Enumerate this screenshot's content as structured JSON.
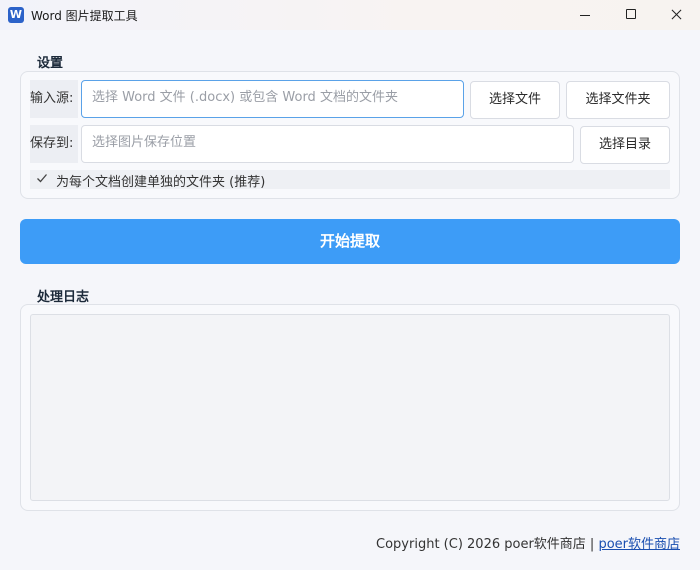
{
  "window": {
    "icon_letter": "W",
    "title": "Word 图片提取工具"
  },
  "settings": {
    "section_title": "设置",
    "source_label": "输入源:",
    "source_placeholder": "选择 Word 文件 (.docx) 或包含 Word 文档的文件夹",
    "select_file_label": "选择文件",
    "select_folder_label": "选择文件夹",
    "save_label": "保存到:",
    "save_placeholder": "选择图片保存位置",
    "select_dir_label": "选择目录",
    "separate_folder_label": "为每个文档创建单独的文件夹 (推荐)",
    "separate_folder_checked": true
  },
  "actions": {
    "start_label": "开始提取"
  },
  "log": {
    "section_title": "处理日志",
    "content": ""
  },
  "footer": {
    "copyright": "Copyright (C) 2026 poer软件商店 | ",
    "link_label": "poer软件商店"
  },
  "colors": {
    "accent": "#3d9cf7",
    "focus_border": "#5aa2e8",
    "link": "#1a4fb0"
  }
}
